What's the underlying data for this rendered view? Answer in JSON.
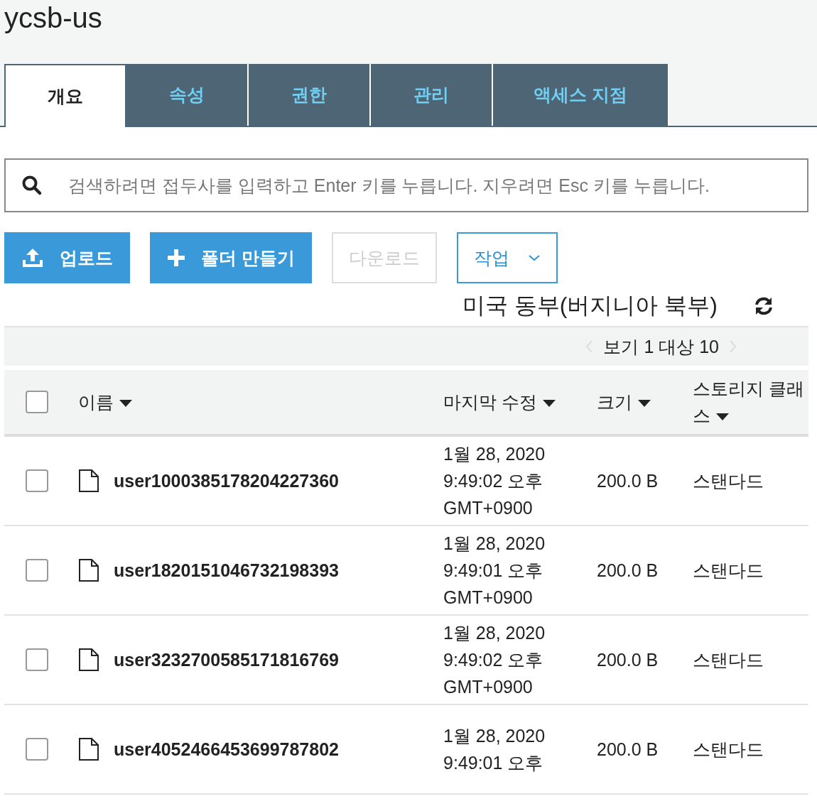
{
  "title": "ycsb-us",
  "tabs": [
    {
      "label": "개요",
      "selected": true
    },
    {
      "label": "속성",
      "selected": false
    },
    {
      "label": "권한",
      "selected": false
    },
    {
      "label": "관리",
      "selected": false
    },
    {
      "label": "액세스 지점",
      "selected": false
    }
  ],
  "search": {
    "placeholder": "검색하려면 접두사를 입력하고 Enter 키를 누릅니다. 지우려면 Esc 키를 누릅니다."
  },
  "buttons": [
    {
      "kind": "upload",
      "label": "업로드",
      "disabled": false
    },
    {
      "kind": "folder",
      "label": "폴더 만들기",
      "disabled": false
    },
    {
      "kind": "plain",
      "label": "다운로드",
      "disabled": true
    },
    {
      "kind": "dropdown",
      "label": "작업",
      "disabled": false
    }
  ],
  "region": "미국 동부(버지니아 북부)",
  "pagination": "보기 1 대상 10",
  "select_all": {
    "checked": false
  },
  "columns": [
    "이름",
    "마지막 수정",
    "크기",
    "스토리지 클래스"
  ],
  "rows": [
    {
      "name": "user1000385178204227360",
      "modified": [
        "1월 28, 2020",
        "9:49:02 오후",
        "GMT+0900"
      ],
      "size": "200.0 B",
      "class": "스탠다드",
      "checked": false
    },
    {
      "name": "user1820151046732198393",
      "modified": [
        "1월 28, 2020",
        "9:49:01 오후",
        "GMT+0900"
      ],
      "size": "200.0 B",
      "class": "스탠다드",
      "checked": false
    },
    {
      "name": "user3232700585171816769",
      "modified": [
        "1월 28, 2020",
        "9:49:02 오후",
        "GMT+0900"
      ],
      "size": "200.0 B",
      "class": "스탠다드",
      "checked": false
    },
    {
      "name": "user4052466453699787802",
      "modified": [
        "1월 28, 2020",
        "9:49:01 오후"
      ],
      "size": "200.0 B",
      "class": "스탠다드",
      "checked": false
    }
  ]
}
